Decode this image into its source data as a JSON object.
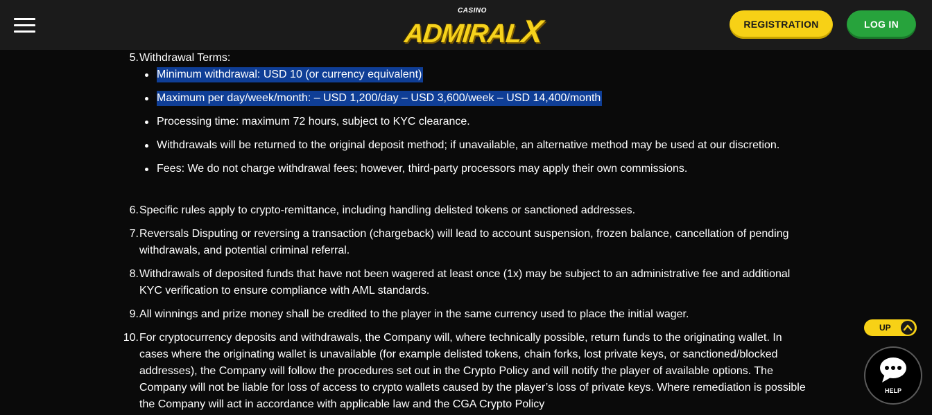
{
  "header": {
    "logo_top": "CASINO",
    "logo_main": "ADMIRAL",
    "logo_x": "X",
    "registration_label": "REGISTRATION",
    "login_label": "LOG IN"
  },
  "terms": {
    "item5": {
      "number": "5.",
      "title": "Withdrawal Terms:",
      "bullets": [
        "Minimum withdrawal: USD 10 (or currency equivalent)",
        "Maximum per day/week/month: – USD 1,200/day – USD 3,600/week – USD 14,400/month",
        "Processing time:  maximum 72 hours, subject to KYC clearance.",
        "Withdrawals will be returned to the original deposit method; if unavailable, an alternative method may be used at our discretion.",
        "Fees: We do not charge withdrawal fees; however, third-party processors may apply their own commissions."
      ]
    },
    "item6": {
      "number": "6.",
      "lines": [
        "Specific rules apply to crypto-remittance, including handling delisted tokens or sanctioned addresses."
      ]
    },
    "item7": {
      "number": "7.",
      "lines": [
        "Reversals Disputing or reversing a transaction (chargeback) will lead to account suspension, frozen balance, cancellation of pending",
        "withdrawals, and potential criminal referral."
      ]
    },
    "item8": {
      "number": "8.",
      "lines": [
        "Withdrawals of deposited funds that have not been wagered at least once (1x) may be subject to an administrative fee and additional",
        "KYC verification to ensure compliance with AML standards."
      ]
    },
    "item9": {
      "number": "9.",
      "lines": [
        "All winnings and prize money shall be credited to the player in the same currency used to place the initial wager."
      ]
    },
    "item10": {
      "number": "10.",
      "lines": [
        "For cryptocurrency deposits and withdrawals, the Company will, where technically possible, return funds to the originating wallet. In",
        "cases where the originating wallet is unavailable (for example delisted tokens, chain forks, lost private keys, or sanctioned/blocked",
        "addresses), the Company will follow the procedures set out in the Crypto Policy and will notify the player of available options. The",
        "Company will not be liable for loss of access to crypto wallets caused by the player’s loss of private keys.  Where remediation is possible",
        "the Company will act in accordance with applicable law and the CGA Crypto Policy"
      ]
    }
  },
  "floating": {
    "up_label": "UP",
    "help_label": "HELP"
  },
  "colors": {
    "accent_yellow": "#f7d116",
    "login_green": "#27a33c",
    "highlight_blue": "#0f3e96",
    "background": "#0a0a0a",
    "header_bg": "#1b1b1b"
  },
  "icons": [
    "hamburger-menu-icon",
    "chevron-up-icon",
    "chat-bubble-icon"
  ]
}
